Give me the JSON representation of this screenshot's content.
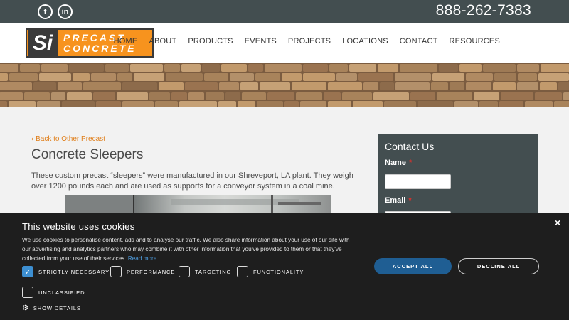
{
  "topbar": {
    "phone": "888-262-7383",
    "social": [
      "facebook-icon",
      "linkedin-icon"
    ]
  },
  "header": {
    "logo_mark": "Si",
    "logo_line1": "PRECAST",
    "logo_line2": "CONCRETE",
    "nav": [
      "HOME",
      "ABOUT",
      "PRODUCTS",
      "EVENTS",
      "PROJECTS",
      "LOCATIONS",
      "CONTACT",
      "RESOURCES"
    ]
  },
  "main": {
    "back_link": "Back to Other Precast",
    "title": "Concrete Sleepers",
    "description": "These custom precast “sleepers” were manufactured in our Shreveport, LA plant. They weigh over 1200 pounds each and are used as supports for a conveyor system in a coal mine."
  },
  "contact": {
    "heading": "Contact Us",
    "name_label": "Name",
    "email_label": "Email",
    "required_mark": "*"
  },
  "cookie": {
    "title": "This website uses cookies",
    "text": "We use cookies to personalise content, ads and to analyse our traffic. We also share information about your use of our site with our advertising and analytics partners who may combine it with other information that you've provided to them or that they've collected from your use of their services.",
    "read_more": "Read more",
    "close": "×",
    "checkboxes": [
      {
        "label": "STRICTLY NECESSARY",
        "checked": true
      },
      {
        "label": "PERFORMANCE",
        "checked": false
      },
      {
        "label": "TARGETING",
        "checked": false
      },
      {
        "label": "FUNCTIONALITY",
        "checked": false
      },
      {
        "label": "UNCLASSIFIED",
        "checked": false
      }
    ],
    "accept": "ACCEPT ALL",
    "decline": "DECLINE ALL",
    "show_details": "SHOW DETAILS"
  },
  "colors": {
    "topbar": "#434e50",
    "accent_orange": "#f7931e",
    "link_orange": "#e07f1b",
    "cookie_bg": "#1e1e1e",
    "accept_blue": "#1f5e93",
    "checkbox_blue": "#3d8fd1"
  }
}
